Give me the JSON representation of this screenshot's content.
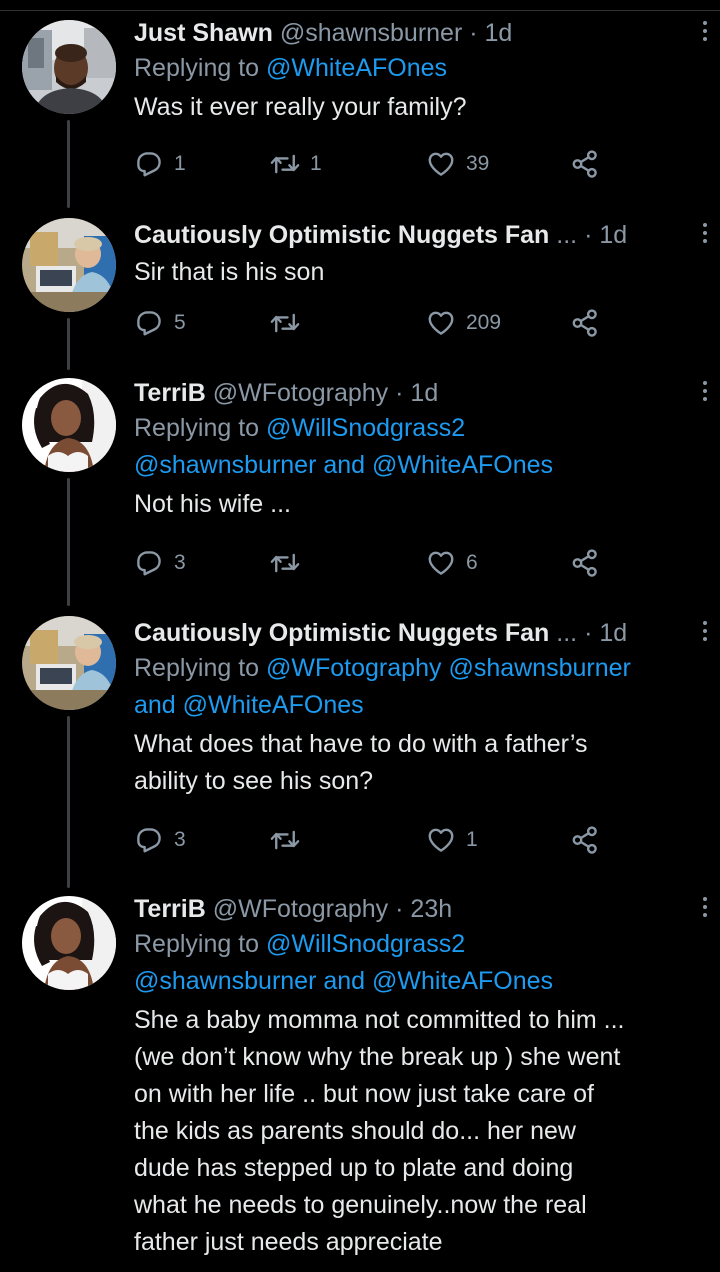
{
  "tweets": [
    {
      "name": "Just Shawn",
      "handle": "@shawnsburner",
      "time": "1d",
      "replying_prefix": "Replying to",
      "replying_line1": "@WhiteAFOnes",
      "replying_line2": "",
      "text": [
        "Was it ever really your family?"
      ],
      "replies": "1",
      "retweets": "1",
      "likes": "39",
      "avatar": "man-portrait"
    },
    {
      "name": "Cautiously Optimistic Nuggets Fan",
      "handle": "...",
      "time": "1d",
      "replying_prefix": "",
      "text": [
        "Sir that is his son"
      ],
      "replies": "5",
      "retweets": "",
      "likes": "209",
      "avatar": "office-photo"
    },
    {
      "name": "TerriB",
      "handle": "@WFotography",
      "time": "1d",
      "replying_prefix": "Replying to",
      "replying_line1": "@WillSnodgrass2",
      "replying_line2_a": "@shawnsburner",
      "replying_line2_and": "and",
      "replying_line2_b": "@WhiteAFOnes",
      "text": [
        "Not his wife ..."
      ],
      "replies": "3",
      "retweets": "",
      "likes": "6",
      "avatar": "woman-portrait"
    },
    {
      "name": "Cautiously Optimistic Nuggets Fan",
      "handle": "...",
      "time": "1d",
      "replying_prefix": "Replying to",
      "replying_line1_a": "@WFotography",
      "replying_line1_b": "@shawnsburner",
      "replying_line2_and": "and",
      "replying_line2_b": "@WhiteAFOnes",
      "text": [
        "What does that have to do with a father’s",
        "ability to see his son?"
      ],
      "replies": "3",
      "retweets": "",
      "likes": "1",
      "avatar": "office-photo"
    },
    {
      "name": "TerriB",
      "handle": "@WFotography",
      "time": "23h",
      "replying_prefix": "Replying to",
      "replying_line1": "@WillSnodgrass2",
      "replying_line2_a": "@shawnsburner",
      "replying_line2_and": "and",
      "replying_line2_b": "@WhiteAFOnes",
      "text": [
        "She a baby momma not committed to him ...",
        "(we don’t know why the break up ) she went",
        "on with her life .. but now just take care of",
        "the kids as parents should do... her new",
        "dude has stepped up to plate and doing",
        "what he needs to genuinely..now the real",
        "father just needs appreciate"
      ],
      "avatar": "woman-portrait"
    }
  ],
  "colors": {
    "background": "#000000",
    "text": "#e7e9ea",
    "secondary": "#8b98a5",
    "link": "#1d9bf0",
    "thread_line": "#3e4144"
  },
  "icons": [
    "reply-icon",
    "retweet-icon",
    "like-icon",
    "share-icon",
    "more-icon"
  ]
}
